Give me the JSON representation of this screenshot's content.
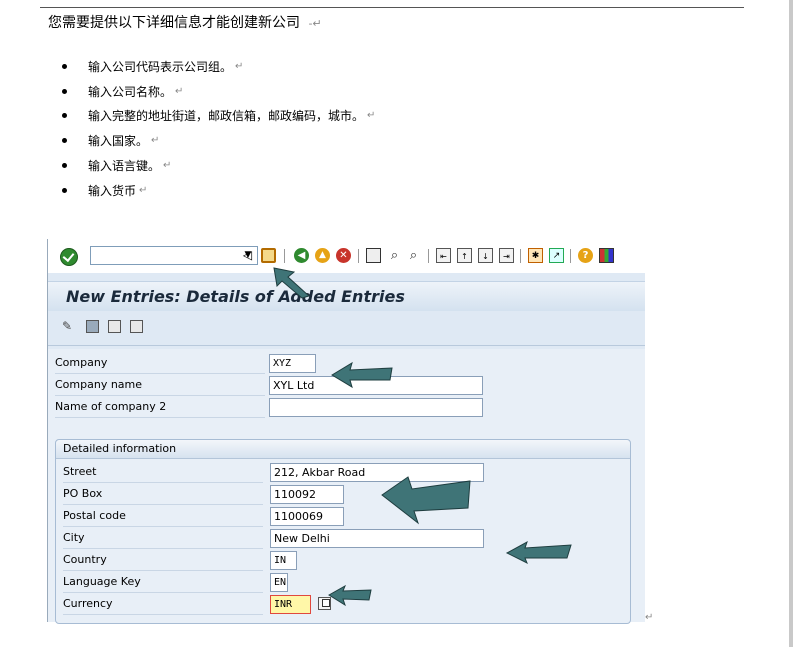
{
  "doc": {
    "intro": "您需要提供以下详细信息才能创建新公司",
    "intro_mark": "-↵",
    "para_mark": "↵",
    "bullets": [
      {
        "text": "输入公司代码表示公司组。",
        "mark": "↵"
      },
      {
        "text": "输入公司名称。",
        "mark": "↵"
      },
      {
        "text": "输入完整的地址街道，邮政信箱，邮政编码，城市。",
        "mark": "↵"
      },
      {
        "text": "输入国家。",
        "mark": "↵"
      },
      {
        "text": "输入语言键。",
        "mark": "↵"
      },
      {
        "text": "输入货币",
        "mark": "↵"
      }
    ]
  },
  "sap": {
    "title": "New Entries: Details of Added Entries",
    "command_field": "",
    "toolbar_icons": [
      "check-icon",
      "back-icon",
      "save-icon",
      "nav-back-icon",
      "exit-icon",
      "cancel-icon",
      "print-icon",
      "find-icon",
      "find-next-icon",
      "first-page-icon",
      "prev-page-icon",
      "next-page-icon",
      "last-page-icon",
      "new-session-icon",
      "shortcut-icon",
      "help-icon",
      "layout-icon"
    ],
    "app_icons": [
      "change-icon",
      "save-entries-icon",
      "prev-entry-icon",
      "next-entry-icon"
    ],
    "fields": {
      "company": {
        "label": "Company",
        "value": "XYZ"
      },
      "company_name": {
        "label": "Company name",
        "value": "XYL Ltd"
      },
      "name2": {
        "label": "Name of company 2",
        "value": ""
      }
    },
    "group_title": "Detailed information",
    "details": {
      "street": {
        "label": "Street",
        "value": "212, Akbar Road"
      },
      "po_box": {
        "label": "PO Box",
        "value": "110092"
      },
      "postal_code": {
        "label": "Postal code",
        "value": "1100069"
      },
      "city": {
        "label": "City",
        "value": "New Delhi"
      },
      "country": {
        "label": "Country",
        "value": "IN"
      },
      "language_key": {
        "label": "Language Key",
        "value": "EN"
      },
      "currency": {
        "label": "Currency",
        "value": "INR"
      }
    }
  },
  "colors": {
    "arrow": "#3f7477",
    "arrow_outline": "#1e3d3f",
    "title_text": "#1b2a3b",
    "focus_border": "#e0483e"
  }
}
